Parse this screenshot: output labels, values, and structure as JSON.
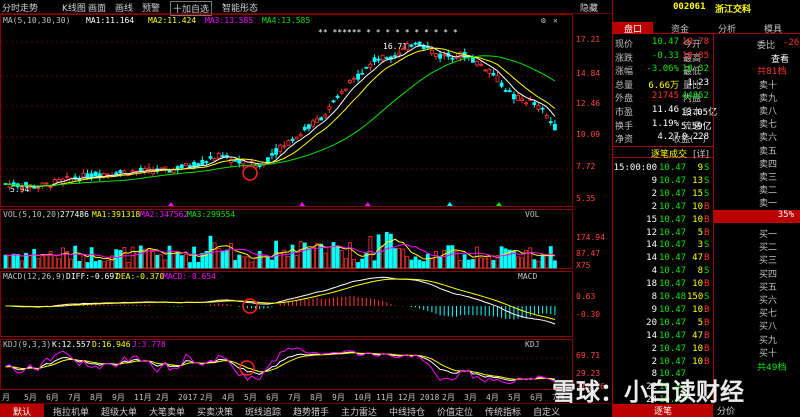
{
  "toolbar": {
    "items": [
      "分时走势",
      "K线图",
      "画面",
      "画线",
      "预警",
      "十加自选",
      "智能彤态"
    ],
    "right": "隐藏"
  },
  "indicators": {
    "ma": {
      "label": "MA(5,10,30,30)",
      "ma1": "MA1:11.164",
      "ma2": "MA2:11.424",
      "ma3": "MA3:13.585",
      "ma4": "MA4:13.585"
    },
    "vol": {
      "label": "VOL(5,10,20)",
      "value": "277486",
      "ma1": "MA1:391318",
      "ma2": "MA2:347562",
      "ma3": "MA3:299554"
    },
    "macd": {
      "label": "MACD(12,26,9)",
      "diff": "DIFF:-0.697",
      "dea": "DEA:-0.370",
      "macd": "MACD:-0.654"
    },
    "kdj": {
      "label": "KDJ(9,3,3)",
      "k": "K:12.557",
      "d": "D:16.946",
      "j": "J:3.778"
    }
  },
  "price_axis": [
    "17.21",
    "14.84",
    "12.46",
    "10.09",
    "7.72",
    "5.35"
  ],
  "vol_axis": [
    "174.94",
    "87.47",
    "X75"
  ],
  "macd_axis": [
    "0.63",
    "-0.30"
  ],
  "kdj_axis": [
    "69.71",
    "29.23",
    "-11.26"
  ],
  "peak_label": "16.71",
  "low_label": "5.94",
  "stars": "** ****** * * * * * *      * * * *",
  "panel_tags": {
    "vol": "VOL",
    "macd": "MACD",
    "kdj": "KDJ"
  },
  "time_axis": [
    "月",
    "5月",
    "6月",
    "7月",
    "8月",
    "9月",
    "11月",
    "2月",
    "2017",
    "2月",
    "4月",
    "5月",
    "6月",
    "7月",
    "8月",
    "9月",
    "10月",
    "11月",
    "12月",
    "2018",
    "2月",
    "3月",
    "4月",
    "5月",
    "6月",
    "7月"
  ],
  "bottom_tabs": [
    "默认",
    "拖拉机单",
    "超级大单",
    "大笔卖单",
    "买卖决策",
    "斑线追踪",
    "趋势猎手",
    "主力雷达",
    "中线持仓",
    "价值定位",
    "传统指标",
    "自定义"
  ],
  "stock": {
    "code": "002061",
    "name": "浙江交科"
  },
  "tabs": [
    "盘口",
    "资金",
    "分析",
    "模具"
  ],
  "quote": [
    {
      "l1": "现价",
      "v1": "10.47",
      "c1": "green",
      "l2": "今开",
      "v2": "10.78",
      "c2": "red"
    },
    {
      "l1": "涨跌",
      "v1": "-0.33",
      "c1": "green",
      "l2": "最高",
      "v2": "10.85",
      "c2": "red"
    },
    {
      "l1": "涨幅",
      "v1": "-3.06%",
      "c1": "green",
      "l2": "最低",
      "v2": "10.32",
      "c2": "green"
    },
    {
      "l1": "总量",
      "v1": "6.66万",
      "c1": "yellow",
      "l2": "量比",
      "v2": "1.23",
      "c2": "white"
    },
    {
      "l1": "外盘",
      "v1": "21745",
      "c1": "red",
      "l2": "内盘",
      "v2": "44852",
      "c2": "green"
    },
    {
      "l1": "市盈",
      "v1": "11.46",
      "c1": "white",
      "l2": "股本",
      "v2": "13.05亿",
      "c2": "white"
    },
    {
      "l1": "换手",
      "v1": "1.19%",
      "c1": "white",
      "l2": "流通",
      "v2": "5.59亿",
      "c2": "white"
    },
    {
      "l1": "净资",
      "v1": "4.27",
      "c1": "white",
      "l2": "收益(一)",
      "v2": "0.228",
      "c2": "white"
    }
  ],
  "ticks_header": "逐笔成交",
  "ticks_more": "[详]",
  "ticks": [
    {
      "t": "15:00:00",
      "p": "10.47",
      "v": "9",
      "f": "S"
    },
    {
      "t": "9",
      "p": "10.47",
      "v": "13",
      "f": "S"
    },
    {
      "t": "2",
      "p": "10.47",
      "v": "15",
      "f": "S"
    },
    {
      "t": "2",
      "p": "10.47",
      "v": "10",
      "f": "B"
    },
    {
      "t": "15",
      "p": "10.47",
      "v": "10",
      "f": "B"
    },
    {
      "t": "12",
      "p": "10.47",
      "v": "5",
      "f": "B"
    },
    {
      "t": "14",
      "p": "10.47",
      "v": "3",
      "f": "S"
    },
    {
      "t": "14",
      "p": "10.47",
      "v": "47",
      "f": "B"
    },
    {
      "t": "4",
      "p": "10.47",
      "v": "8",
      "f": "S"
    },
    {
      "t": "18",
      "p": "10.47",
      "v": "10",
      "f": "B"
    },
    {
      "t": "8",
      "p": "10.48",
      "v": "150",
      "f": "S"
    },
    {
      "t": "9",
      "p": "10.47",
      "v": "10",
      "f": "B"
    },
    {
      "t": "20",
      "p": "10.47",
      "v": "5",
      "f": "B"
    },
    {
      "t": "14",
      "p": "10.47",
      "v": "47",
      "f": "B"
    },
    {
      "t": "2",
      "p": "10.47",
      "v": "10",
      "f": "B"
    },
    {
      "t": "2",
      "p": "10.47",
      "v": "10",
      "f": "B"
    },
    {
      "t": "8",
      "p": "10.47",
      "v": "",
      "f": ""
    },
    {
      "t": "22",
      "p": "10.47",
      "v": "",
      "f": ""
    },
    {
      "t": "24",
      "p": "10.47",
      "v": "",
      "f": ""
    }
  ],
  "orderbook": {
    "ratio": "委比",
    "ratio_v": "-26",
    "query": "查看",
    "sell_total": "共81档",
    "sells": [
      "卖十",
      "卖九",
      "卖八",
      "卖七",
      "卖六",
      "卖五",
      "卖四",
      "卖三",
      "卖二",
      "卖一"
    ],
    "mid": "35%",
    "buys": [
      "买一",
      "买二",
      "买三",
      "买四",
      "买五",
      "买六",
      "买七",
      "买八",
      "买九",
      "买十"
    ],
    "buy_total": "共49档"
  },
  "bottom_right": {
    "a": "逐笔",
    "b": "分价"
  },
  "watermark": "雪球：小白读财经",
  "colors": {
    "up": "#ff3232",
    "down": "#00ffff",
    "ma1": "#ffffff",
    "ma2": "#ffff00",
    "ma3": "#ff00ff",
    "ma4": "#00e600",
    "grid": "#8b0000",
    "circle": "#ff2020"
  }
}
